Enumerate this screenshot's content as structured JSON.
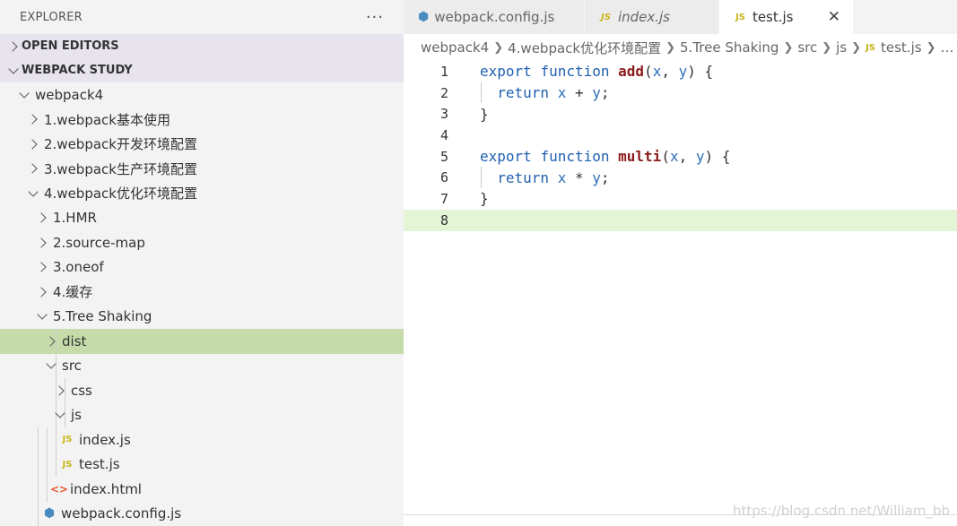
{
  "sidebar": {
    "title": "EXPLORER",
    "more_label": "···",
    "open_editors_label": "OPEN EDITORS",
    "workspace_label": "WEBPACK STUDY",
    "tree": [
      {
        "label": "webpack4",
        "level": 0,
        "type": "folder",
        "expanded": true
      },
      {
        "label": "1.webpack基本使用",
        "level": 1,
        "type": "folder",
        "expanded": false
      },
      {
        "label": "2.webpack开发环境配置",
        "level": 1,
        "type": "folder",
        "expanded": false
      },
      {
        "label": "3.webpack生产环境配置",
        "level": 1,
        "type": "folder",
        "expanded": false
      },
      {
        "label": "4.webpack优化环境配置",
        "level": 1,
        "type": "folder",
        "expanded": true
      },
      {
        "label": "1.HMR",
        "level": 2,
        "type": "folder",
        "expanded": false
      },
      {
        "label": "2.source-map",
        "level": 2,
        "type": "folder",
        "expanded": false
      },
      {
        "label": "3.oneof",
        "level": 2,
        "type": "folder",
        "expanded": false
      },
      {
        "label": "4.缓存",
        "level": 2,
        "type": "folder",
        "expanded": false
      },
      {
        "label": "5.Tree Shaking",
        "level": 2,
        "type": "folder",
        "expanded": true
      },
      {
        "label": "dist",
        "level": 3,
        "type": "folder",
        "expanded": false,
        "selected": true
      },
      {
        "label": "src",
        "level": 3,
        "type": "folder",
        "expanded": true
      },
      {
        "label": "css",
        "level": 4,
        "type": "folder",
        "expanded": false
      },
      {
        "label": "js",
        "level": 4,
        "type": "folder",
        "expanded": true
      },
      {
        "label": "index.js",
        "level": 5,
        "type": "js"
      },
      {
        "label": "test.js",
        "level": 5,
        "type": "js"
      },
      {
        "label": "index.html",
        "level": 4,
        "type": "html"
      },
      {
        "label": "webpack.config.js",
        "level": 3,
        "type": "webpack"
      }
    ]
  },
  "tabs": [
    {
      "label": "webpack.config.js",
      "icon": "webpack-cube-icon",
      "active": false,
      "italic": false
    },
    {
      "label": "index.js",
      "icon": "js-icon",
      "active": false,
      "italic": true
    },
    {
      "label": "test.js",
      "icon": "js-icon",
      "active": true,
      "italic": false
    }
  ],
  "icons": {
    "js_badge": "JS",
    "close": "✕",
    "html": "<>"
  },
  "breadcrumb": [
    "webpack4",
    "4.webpack优化环境配置",
    "5.Tree Shaking",
    "src",
    "js",
    "test.js",
    "…"
  ],
  "code_lines": [
    {
      "num": "1",
      "tokens": [
        [
          "kw",
          "export"
        ],
        [
          "",
          " "
        ],
        [
          "kw",
          "function"
        ],
        [
          "",
          " "
        ],
        [
          "fn",
          "add"
        ],
        [
          "",
          "("
        ],
        [
          "param",
          "x"
        ],
        [
          "",
          ", "
        ],
        [
          "param",
          "y"
        ],
        [
          "",
          ") {"
        ]
      ]
    },
    {
      "num": "2",
      "tokens": [
        [
          "",
          "  "
        ],
        [
          "kw",
          "return"
        ],
        [
          "",
          " "
        ],
        [
          "param",
          "x"
        ],
        [
          "",
          " + "
        ],
        [
          "param",
          "y"
        ],
        [
          "",
          ";"
        ]
      ]
    },
    {
      "num": "3",
      "tokens": [
        [
          "",
          "}"
        ]
      ]
    },
    {
      "num": "4",
      "tokens": []
    },
    {
      "num": "5",
      "tokens": [
        [
          "kw",
          "export"
        ],
        [
          "",
          " "
        ],
        [
          "kw",
          "function"
        ],
        [
          "",
          " "
        ],
        [
          "fn",
          "multi"
        ],
        [
          "",
          "("
        ],
        [
          "param",
          "x"
        ],
        [
          "",
          ", "
        ],
        [
          "param",
          "y"
        ],
        [
          "",
          ") {"
        ]
      ]
    },
    {
      "num": "6",
      "tokens": [
        [
          "",
          "  "
        ],
        [
          "kw",
          "return"
        ],
        [
          "",
          " "
        ],
        [
          "param",
          "x"
        ],
        [
          "",
          " * "
        ],
        [
          "param",
          "y"
        ],
        [
          "",
          ";"
        ]
      ]
    },
    {
      "num": "7",
      "tokens": [
        [
          "",
          "}"
        ]
      ]
    },
    {
      "num": "8",
      "tokens": [],
      "current": true
    }
  ],
  "watermark": "https://blog.csdn.net/William_bb",
  "colors": {
    "selection": "#c5dcaa",
    "current_line": "#e3f5d4",
    "keyword": "#1f5fb0",
    "function": "#8b1a1a",
    "js_icon": "#c8b518"
  }
}
